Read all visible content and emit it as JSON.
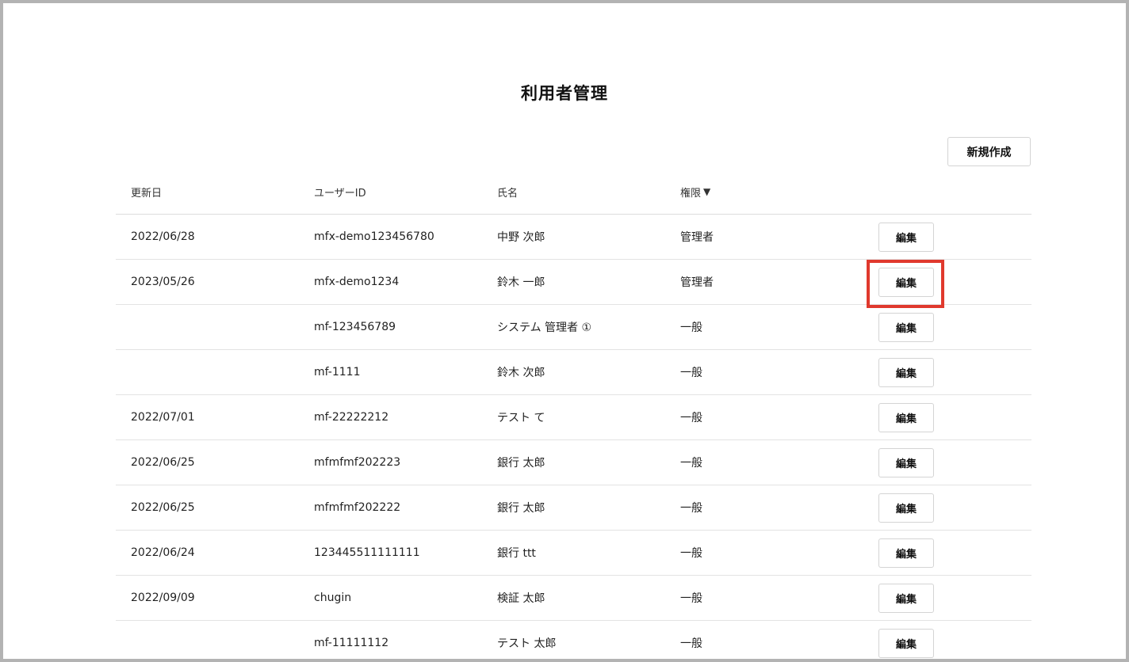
{
  "page": {
    "title": "利用者管理"
  },
  "toolbar": {
    "new_label": "新規作成"
  },
  "table": {
    "headers": {
      "date": "更新日",
      "user_id": "ユーザーID",
      "name": "氏名",
      "role": "権限",
      "sort_indicator": "▼"
    },
    "edit_label": "編集",
    "rows": [
      {
        "date": "2022/06/28",
        "user_id": "mfx-demo123456780",
        "name": "中野 次郎",
        "role": "管理者"
      },
      {
        "date": "2023/05/26",
        "user_id": "mfx-demo1234",
        "name": "鈴木 一郎",
        "role": "管理者"
      },
      {
        "date": "",
        "user_id": "mf-123456789",
        "name": "システム 管理者 ①",
        "role": "一般"
      },
      {
        "date": "",
        "user_id": "mf-1111",
        "name": "鈴木 次郎",
        "role": "一般"
      },
      {
        "date": "2022/07/01",
        "user_id": "mf-22222212",
        "name": "テスト て",
        "role": "一般"
      },
      {
        "date": "2022/06/25",
        "user_id": "mfmfmf202223",
        "name": "銀行 太郎",
        "role": "一般"
      },
      {
        "date": "2022/06/25",
        "user_id": "mfmfmf202222",
        "name": "銀行 太郎",
        "role": "一般"
      },
      {
        "date": "2022/06/24",
        "user_id": "123445511111111",
        "name": "銀行 ttt",
        "role": "一般"
      },
      {
        "date": "2022/09/09",
        "user_id": "chugin",
        "name": "検証 太郎",
        "role": "一般"
      },
      {
        "date": "",
        "user_id": "mf-11111112",
        "name": "テスト 太郎",
        "role": "一般"
      }
    ]
  },
  "highlight": {
    "color": "#e0392d",
    "target_row": 1
  }
}
